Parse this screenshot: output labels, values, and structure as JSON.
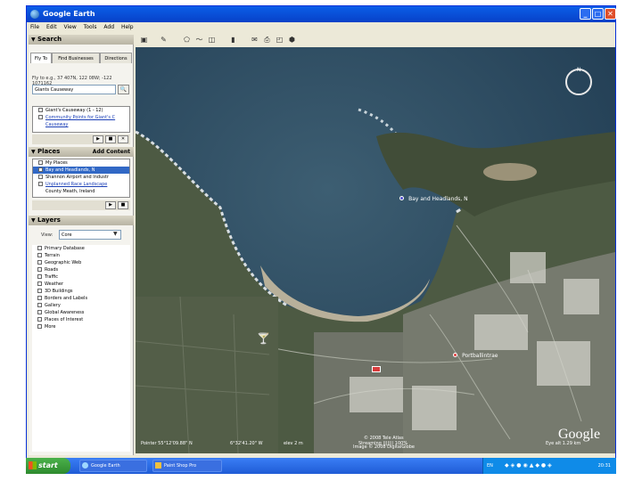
{
  "window": {
    "title": "Google Earth"
  },
  "menu": [
    "File",
    "Edit",
    "View",
    "Tools",
    "Add",
    "Help"
  ],
  "search": {
    "header": "Search",
    "tabs": [
      "Fly To",
      "Find Businesses",
      "Directions"
    ],
    "flyto_hint": "Fly to e.g., 37 407N, 122 08W; -122 1071162",
    "query": "Giants Causeway",
    "results": [
      "Giant's Causeway (1 - 12)",
      "Community Points for Giant's C",
      "Causeway"
    ]
  },
  "places": {
    "header": "Places",
    "add_content": "Add Content",
    "items": [
      "My Places",
      "Bay and Headlands, N",
      "Shannon Airport and Industr",
      "Unplanned Race Landscape",
      "County Meath, Ireland"
    ]
  },
  "layers": {
    "header": "Layers",
    "view_label": "View:",
    "view_value": "Core",
    "items": [
      "Primary Database",
      "Terrain",
      "Geographic Web",
      "Roads",
      "Traffic",
      "Weather",
      "3D Buildings",
      "Borders and Labels",
      "Gallery",
      "Global Awareness",
      "Places of Interest",
      "More"
    ]
  },
  "map": {
    "labels": [
      "Bay and Headlands, N",
      "Portballintrae"
    ],
    "copyright_1": "© 2008 Tele Atlas",
    "copyright_2": "Image © 2008 DigitalGlobe",
    "logo": "Google",
    "status_pointer": "Pointer  55°12'09.88\" N",
    "status_lon": "6°32'41.20\" W",
    "status_elev": "elev   2 m",
    "status_stream": "Streaming ||||||| 100%",
    "status_eye": "Eye alt  1.29 km"
  },
  "taskbar": {
    "start": "start",
    "tasks": [
      "Google Earth",
      "Paint Shop Pro"
    ],
    "lang": "EN",
    "clock": "20:31"
  }
}
